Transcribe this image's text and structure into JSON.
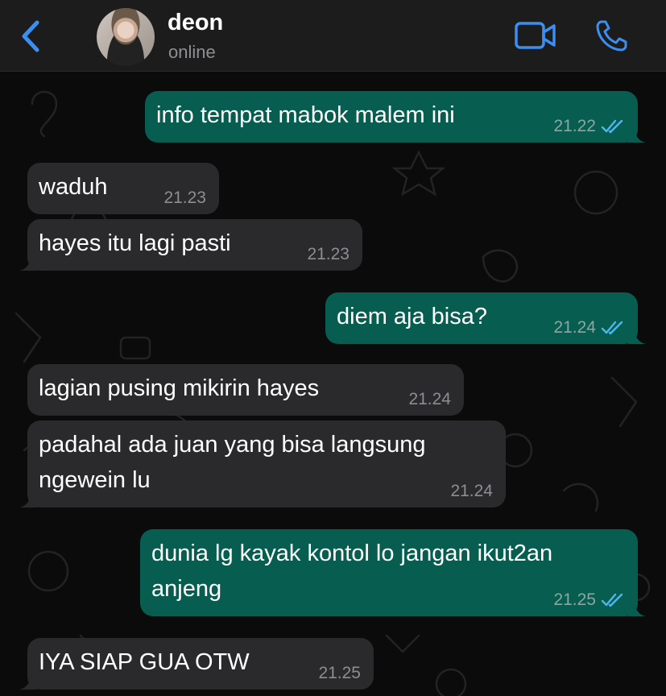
{
  "header": {
    "contact_name": "deon",
    "status": "online",
    "icons": {
      "back": "chevron-left-icon",
      "video": "video-camera-icon",
      "call": "phone-icon"
    },
    "accent_color": "#3b8ff0"
  },
  "messages": [
    {
      "direction": "out",
      "text": "info tempat mabok malem ini",
      "time": "21.22",
      "read": true
    },
    {
      "direction": "in",
      "text": "waduh",
      "time": "21.23"
    },
    {
      "direction": "in",
      "text": "hayes itu lagi pasti",
      "time": "21.23"
    },
    {
      "direction": "out",
      "text": "diem aja bisa?",
      "time": "21.24",
      "read": true
    },
    {
      "direction": "in",
      "text": "lagian pusing mikirin hayes",
      "time": "21.24"
    },
    {
      "direction": "in",
      "text": "padahal ada juan yang bisa langsung\nngewein lu",
      "time": "21.24"
    },
    {
      "direction": "out",
      "text": "dunia lg kayak kontol lo jangan ikut2an\nanjeng",
      "time": "21.25",
      "read": true
    },
    {
      "direction": "in",
      "text": "IYA SIAP GUA OTW",
      "time": "21.25"
    }
  ],
  "colors": {
    "outgoing_bubble": "#075d4f",
    "incoming_bubble": "#2a2a2c",
    "read_ticks": "#4fb6ec"
  }
}
